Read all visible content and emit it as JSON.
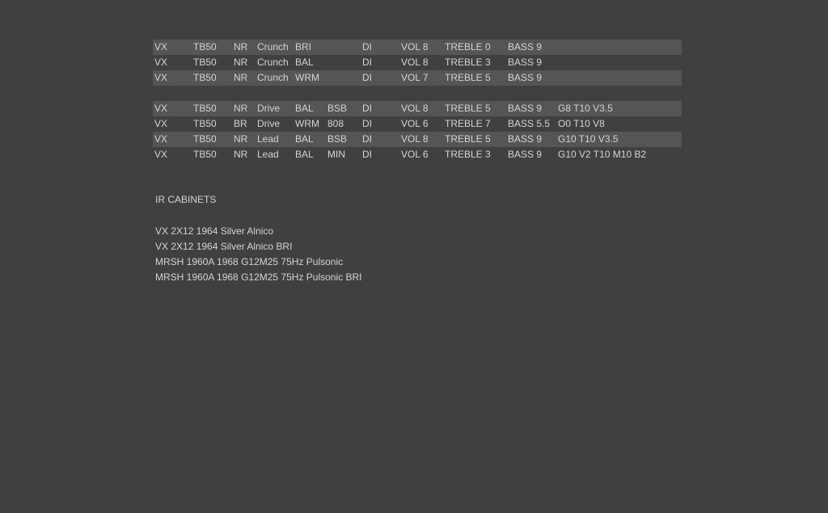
{
  "table1": [
    [
      "VX",
      "TB50",
      "NR",
      "Crunch",
      "BRI",
      "",
      "DI",
      "VOL 8",
      "TREBLE 0",
      "BASS 9",
      ""
    ],
    [
      "VX",
      "TB50",
      "NR",
      "Crunch",
      "BAL",
      "",
      "DI",
      "VOL 8",
      "TREBLE 3",
      "BASS 9",
      ""
    ],
    [
      "VX",
      "TB50",
      "NR",
      "Crunch",
      "WRM",
      "",
      "DI",
      "VOL 7",
      "TREBLE 5",
      "BASS 9",
      ""
    ]
  ],
  "table2": [
    [
      "VX",
      "TB50",
      "NR",
      "Drive",
      "BAL",
      "BSB",
      "DI",
      "VOL 8",
      "TREBLE 5",
      "BASS 9",
      "G8 T10 V3.5"
    ],
    [
      "VX",
      "TB50",
      "BR",
      "Drive",
      "WRM",
      "808",
      "DI",
      "VOL 6",
      "TREBLE 7",
      "BASS 5.5",
      "O0 T10 V8"
    ],
    [
      "VX",
      "TB50",
      "NR",
      "Lead",
      "BAL",
      "BSB",
      "DI",
      "VOL 8",
      "TREBLE 5",
      "BASS 9",
      "G10 T10 V3.5"
    ],
    [
      "VX",
      "TB50",
      "NR",
      "Lead",
      "BAL",
      "MIN",
      "DI",
      "VOL 6",
      "TREBLE 3",
      "BASS 9",
      "G10 V2 T10 M10 B2"
    ]
  ],
  "ir_section": {
    "title": "IR CABINETS",
    "items": [
      "VX 2X12 1964 Silver Alnico",
      "VX 2X12 1964 Silver Alnico BRI",
      "MRSH 1960A 1968 G12M25 75Hz Pulsonic",
      "MRSH 1960A 1968 G12M25 75Hz Pulsonic BRI"
    ]
  },
  "colors": {
    "background": "#404040",
    "row_shade": "#555555",
    "text": "#d4d4d4"
  }
}
